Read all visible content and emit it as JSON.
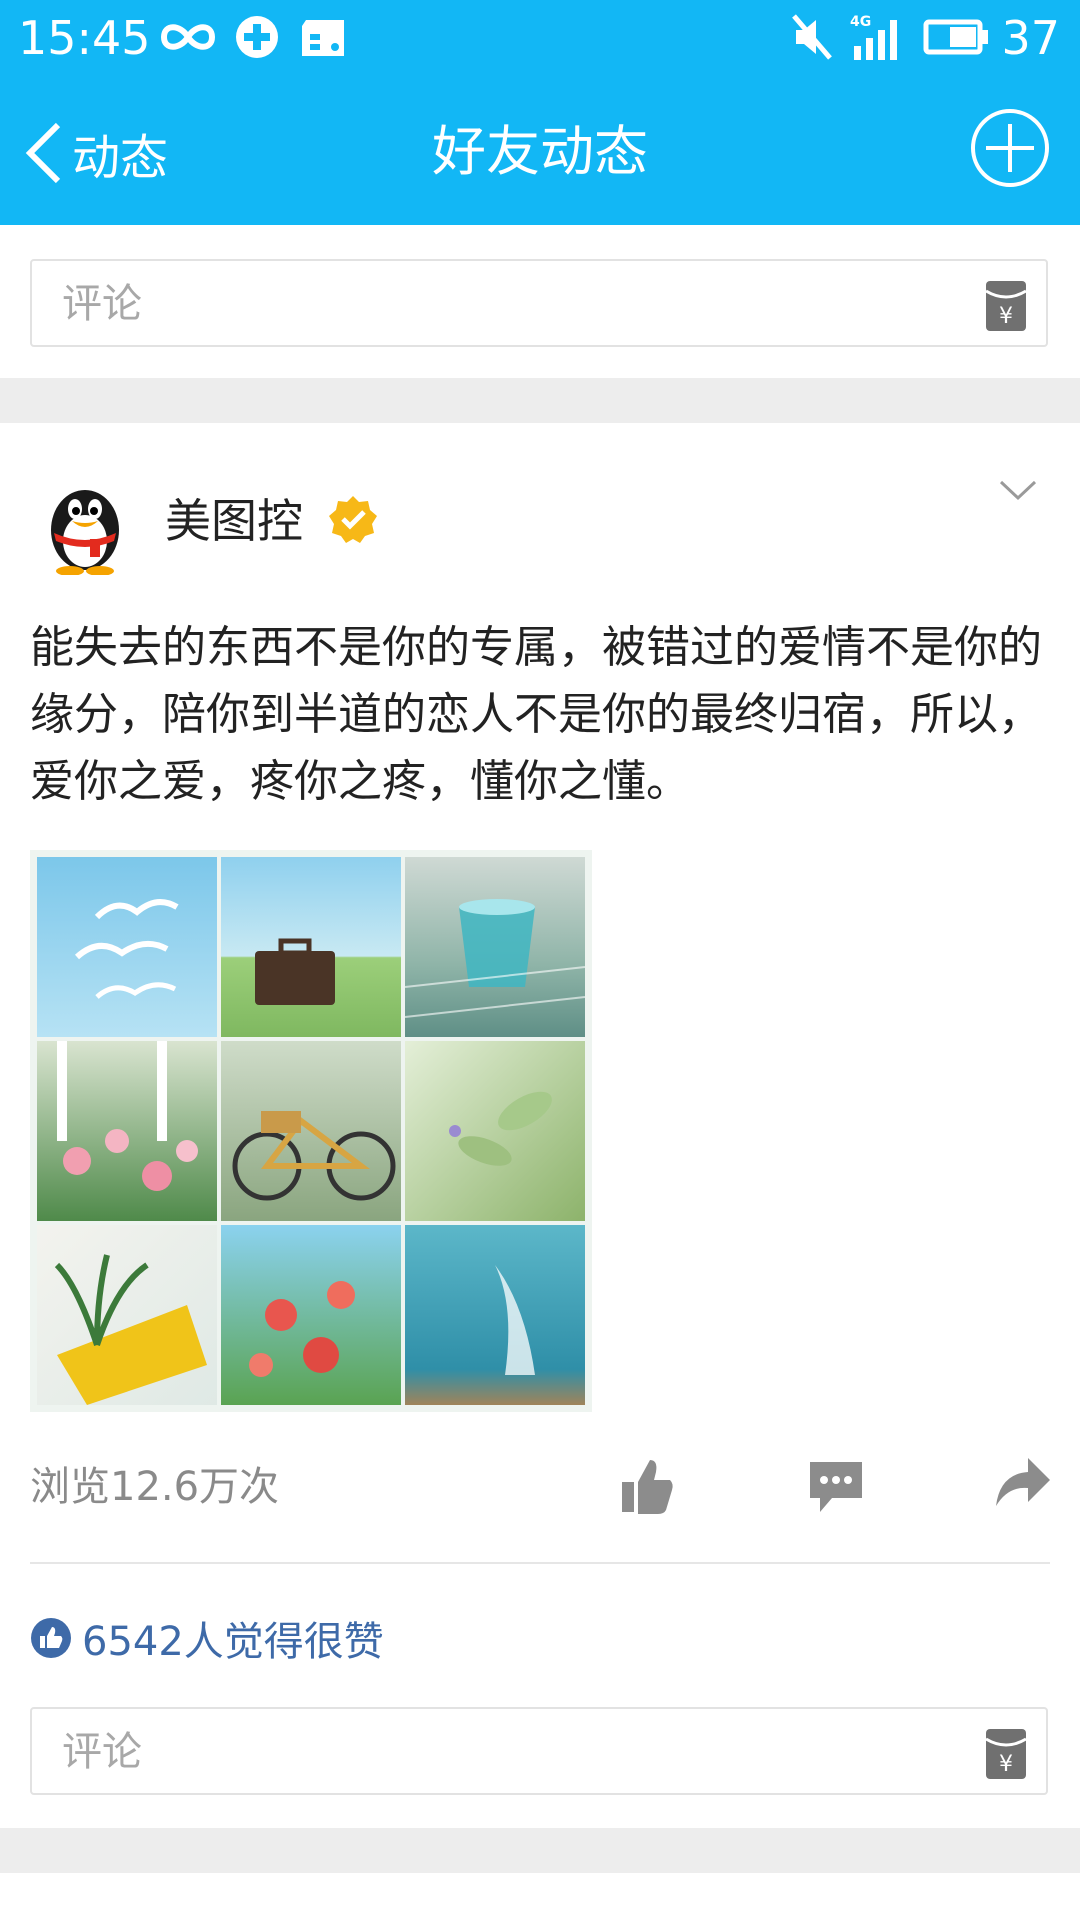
{
  "status_bar": {
    "time": "15:45",
    "network": "4G",
    "battery": "37"
  },
  "nav": {
    "back_label": "动态",
    "title": "好友动态"
  },
  "top_comment": {
    "placeholder": "评论"
  },
  "post": {
    "username": "美图控",
    "text": "能失去的东西不是你的专属，被错过的爱情不是你的缘分，陪你到半道的恋人不是你的最终归宿，所以，爱你之爱，疼你之疼，懂你之懂。",
    "views": "浏览12.6万次",
    "likes_text": "6542人觉得很赞",
    "comment_placeholder": "评论"
  },
  "colors": {
    "header_blue": "#12b7f5",
    "link_blue": "#3e6aa8",
    "verified_gold": "#f7b817"
  }
}
